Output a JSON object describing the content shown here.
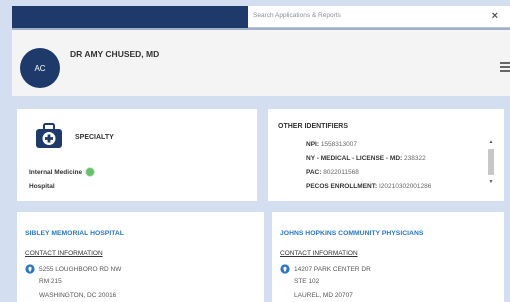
{
  "search": {
    "placeholder": "Search Applications & Reports",
    "close_label": "×"
  },
  "profile": {
    "avatar_initials": "AC",
    "name": "DR AMY CHUSED, MD"
  },
  "specialty": {
    "label": "SPECIALTY",
    "items": [
      "Internal Medicine",
      "Hospital"
    ],
    "icon": "medical-bag-icon"
  },
  "other_identifiers": {
    "title": "OTHER IDENTIFIERS",
    "rows": [
      {
        "key": "NPI:",
        "value": "1558313007"
      },
      {
        "key": "NY - MEDICAL - LICENSE - MD:",
        "value": "238322"
      },
      {
        "key": "PAC:",
        "value": "8022011568"
      },
      {
        "key": "PECOS ENROLLMENT:",
        "value": "I20210302001286"
      }
    ]
  },
  "sibley": {
    "title": "SIBLEY MEMORIAL HOSPITAL",
    "contact_heading": "CONTACT INFORMATION",
    "address_lines": [
      "5255 LOUGHBORO RD NW",
      "RM 215",
      "WASHINGTON, DC 20016"
    ]
  },
  "jhcp": {
    "title": "JOHNS HOPKINS COMMUNITY PHYSICIANS",
    "contact_heading": "CONTACT INFORMATION",
    "address_lines": [
      "14207 PARK CENTER DR",
      "STE 102",
      "LAUREL, MD 20707"
    ]
  },
  "colors": {
    "navy": "#1e3a6b",
    "link_blue": "#2a76c6",
    "badge_green": "#66c26a",
    "background": "#d3dff0"
  }
}
